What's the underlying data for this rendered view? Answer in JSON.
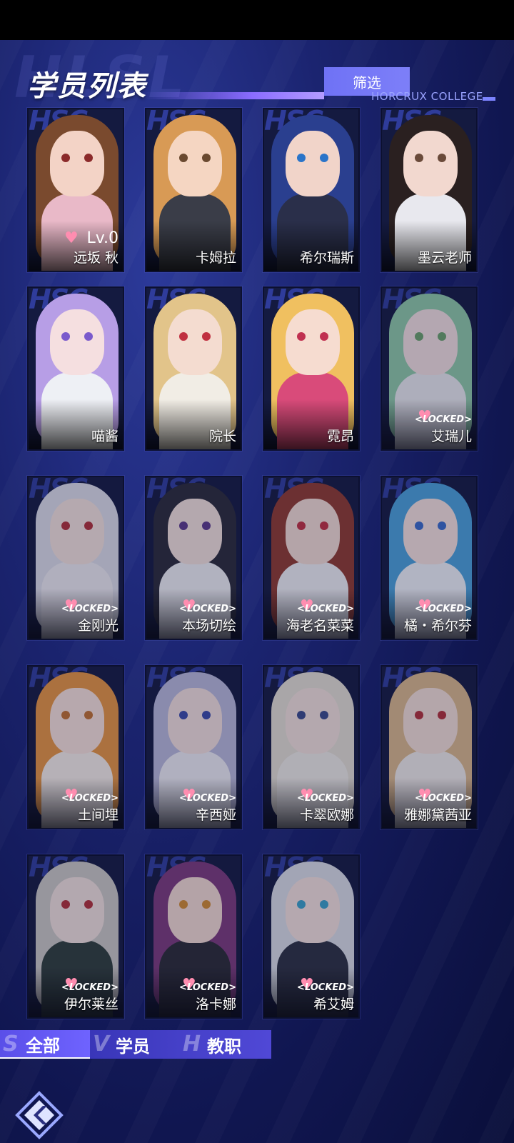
{
  "header": {
    "title": "学员列表",
    "filter_label": "筛选",
    "subtitle": "HORCRUX COLLEGE"
  },
  "cards": [
    {
      "name": "远坂 秋",
      "status": "Lv.0",
      "locked": false,
      "palette": [
        "#7a4a2e",
        "#f3d3c6",
        "#e9b9c8",
        "#8b2a2a"
      ]
    },
    {
      "name": "卡姆拉",
      "status": "",
      "locked": false,
      "palette": [
        "#d89a55",
        "#f5d6c2",
        "#3a3d48",
        "#6a4a30"
      ]
    },
    {
      "name": "希尔瑞斯",
      "status": "",
      "locked": false,
      "palette": [
        "#2a3f8f",
        "#f1d4c9",
        "#2a2f4a",
        "#2a74c9"
      ]
    },
    {
      "name": "墨云老师",
      "status": "",
      "locked": false,
      "palette": [
        "#2a2020",
        "#f2d8cf",
        "#e8e8ee",
        "#6a4a3a"
      ]
    },
    {
      "name": "喵酱",
      "status": "",
      "locked": false,
      "palette": [
        "#b79ee6",
        "#f5dfe0",
        "#eef0f5",
        "#7a5acc"
      ]
    },
    {
      "name": "院长",
      "status": "",
      "locked": false,
      "palette": [
        "#e2c48a",
        "#f4dcd0",
        "#f1ede5",
        "#c03040"
      ]
    },
    {
      "name": "霓昂",
      "status": "",
      "locked": false,
      "palette": [
        "#f0c060",
        "#f6dcd0",
        "#d94b7a",
        "#c03050"
      ]
    },
    {
      "name": "艾瑞儿",
      "status": "<LOCKED>",
      "locked": true,
      "palette": [
        "#8ec8a6",
        "#f1dede",
        "#e8e8ec",
        "#6aa06a"
      ]
    },
    {
      "name": "金刚光",
      "status": "<LOCKED>",
      "locked": true,
      "palette": [
        "#dcdce6",
        "#f3e1dc",
        "#ece9ef",
        "#b03038"
      ]
    },
    {
      "name": "本场切绘",
      "status": "<LOCKED>",
      "locked": true,
      "palette": [
        "#2a2a38",
        "#f2dfda",
        "#eeeef2",
        "#5a3a8a"
      ]
    },
    {
      "name": "海老名菜菜",
      "status": "<LOCKED>",
      "locked": true,
      "palette": [
        "#8e3a2e",
        "#f2dad2",
        "#eeeef2",
        "#c03040"
      ]
    },
    {
      "name": "橘・希尔芬",
      "status": "<LOCKED>",
      "locked": true,
      "palette": [
        "#4aa0d8",
        "#f4e0dc",
        "#eef0f6",
        "#3a6ac8"
      ]
    },
    {
      "name": "土间埋",
      "status": "<LOCKED>",
      "locked": true,
      "palette": [
        "#e59440",
        "#f6e0d8",
        "#f4ece6",
        "#c07030"
      ]
    },
    {
      "name": "辛西娅",
      "status": "<LOCKED>",
      "locked": true,
      "palette": [
        "#b8b8d8",
        "#f1dedc",
        "#ecebf2",
        "#3a4aa8"
      ]
    },
    {
      "name": "卡翠欧娜",
      "status": "<LOCKED>",
      "locked": true,
      "palette": [
        "#e2ddd2",
        "#f2e0da",
        "#ece9e4",
        "#3a4a8a"
      ]
    },
    {
      "name": "雅娜黛茜亚",
      "status": "<LOCKED>",
      "locked": true,
      "palette": [
        "#d9b68a",
        "#f2ddd4",
        "#eee9e6",
        "#b03038"
      ]
    },
    {
      "name": "伊尔莱丝",
      "status": "<LOCKED>",
      "locked": true,
      "palette": [
        "#c9c6c2",
        "#f0dfdc",
        "#2f3d3a",
        "#b03038"
      ]
    },
    {
      "name": "洛卡娜",
      "status": "<LOCKED>",
      "locked": true,
      "palette": [
        "#7a3a7a",
        "#f2d8d0",
        "#2a2a34",
        "#d08a30"
      ]
    },
    {
      "name": "希艾姆",
      "status": "<LOCKED>",
      "locked": true,
      "palette": [
        "#d8dce4",
        "#f3e0dc",
        "#2c3040",
        "#3aa0c8"
      ]
    }
  ],
  "tabs": [
    {
      "label": "全部",
      "icon_letter": "S"
    },
    {
      "label": "学员",
      "icon_letter": "V"
    },
    {
      "label": "教职",
      "icon_letter": "H"
    }
  ],
  "card_header_text": "HSC",
  "background_word": "HLSL",
  "colors": {
    "accent": "#6f63ff",
    "heart": "#ff8db0",
    "subtitle": "#9aa3ff"
  }
}
